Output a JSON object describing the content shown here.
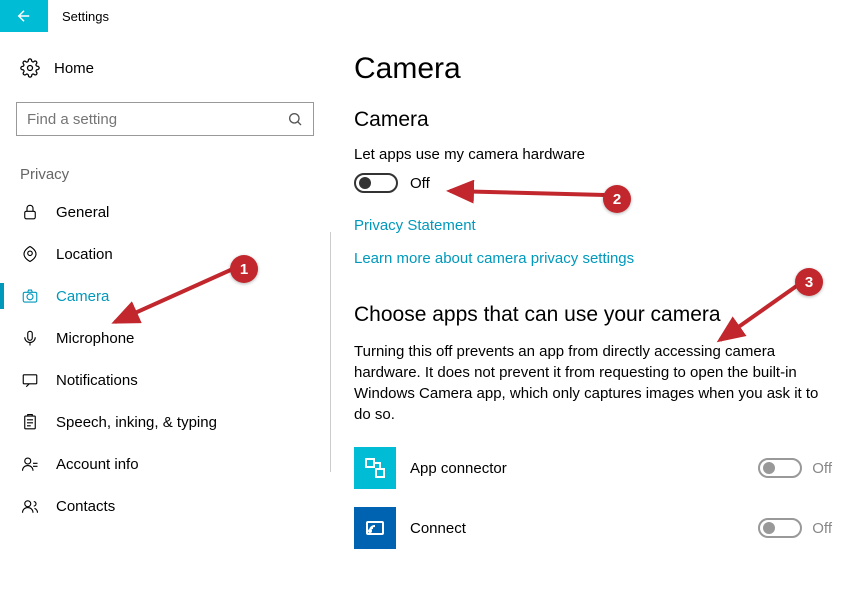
{
  "titlebar": {
    "title": "Settings"
  },
  "sidebar": {
    "home_label": "Home",
    "search_placeholder": "Find a setting",
    "category_label": "Privacy",
    "items": [
      {
        "label": "General"
      },
      {
        "label": "Location"
      },
      {
        "label": "Camera"
      },
      {
        "label": "Microphone"
      },
      {
        "label": "Notifications"
      },
      {
        "label": "Speech, inking, & typing"
      },
      {
        "label": "Account info"
      },
      {
        "label": "Contacts"
      }
    ]
  },
  "main": {
    "page_title": "Camera",
    "section1_heading": "Camera",
    "setting_label": "Let apps use my camera hardware",
    "toggle_state": "Off",
    "link_privacy": "Privacy Statement",
    "link_learnmore": "Learn more about camera privacy settings",
    "section2_heading": "Choose apps that can use your camera",
    "section2_desc": "Turning this off prevents an app from directly accessing camera hardware. It does not prevent it from requesting to open the built-in Windows Camera app, which only captures images when you ask it to do so.",
    "apps": [
      {
        "name": "App connector",
        "state": "Off"
      },
      {
        "name": "Connect",
        "state": "Off"
      }
    ]
  },
  "annotations": {
    "badge1": "1",
    "badge2": "2",
    "badge3": "3"
  }
}
